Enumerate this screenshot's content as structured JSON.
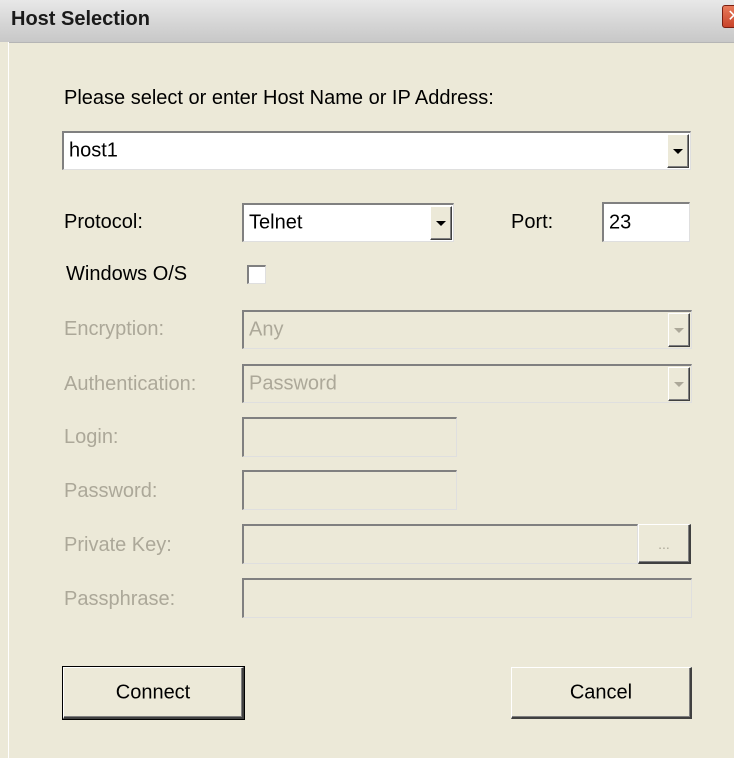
{
  "window": {
    "title": "Host Selection",
    "close_glyph": "✕"
  },
  "prompt": "Please select or enter Host Name or IP Address:",
  "host": {
    "value": "host1"
  },
  "protocol": {
    "label": "Protocol:",
    "value": "Telnet"
  },
  "port": {
    "label": "Port:",
    "value": "23"
  },
  "windows_os": {
    "label": "Windows O/S",
    "checked": false
  },
  "encryption": {
    "label": "Encryption:",
    "value": "Any"
  },
  "authentication": {
    "label": "Authentication:",
    "value": "Password"
  },
  "login": {
    "label": "Login:",
    "value": ""
  },
  "password": {
    "label": "Password:",
    "value": ""
  },
  "private_key": {
    "label": "Private Key:",
    "value": "",
    "browse_label": "..."
  },
  "passphrase": {
    "label": "Passphrase:",
    "value": ""
  },
  "buttons": {
    "connect": "Connect",
    "cancel": "Cancel"
  },
  "colors": {
    "dialog_bg": "#ece9d8",
    "disabled_text": "#aca899",
    "field_border": "#7f9db9"
  }
}
